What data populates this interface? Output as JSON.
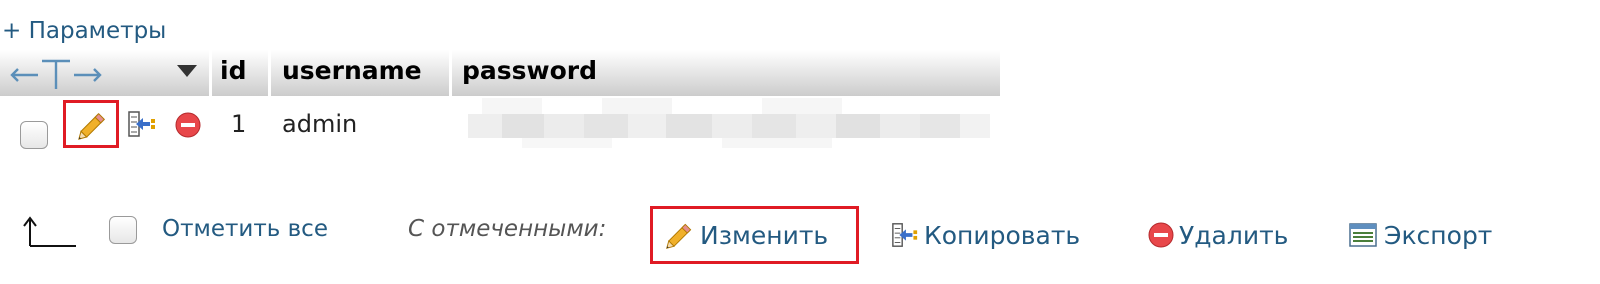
{
  "options": {
    "label": "+ Параметры"
  },
  "table": {
    "columns": [
      "id",
      "username",
      "password"
    ],
    "rows": [
      {
        "id": "1",
        "username": "admin",
        "password": ""
      }
    ]
  },
  "bottom": {
    "check_all_label": "Отметить все",
    "with_selected_label": "С отмеченными:",
    "actions": {
      "edit": "Изменить",
      "copy": "Копировать",
      "delete": "Удалить",
      "export": "Экспорт"
    }
  },
  "colors": {
    "link": "#235a81",
    "highlight": "#e01b24",
    "header_gradient_end": "#cccccc"
  },
  "icons": {
    "column_resize": "column-resize-icon",
    "sort": "sort-triangle-icon",
    "edit": "pencil-icon",
    "copy": "copy-insert-icon",
    "delete": "delete-icon",
    "export": "export-icon",
    "check_all_arrow": "arrow-up-corner-icon"
  }
}
